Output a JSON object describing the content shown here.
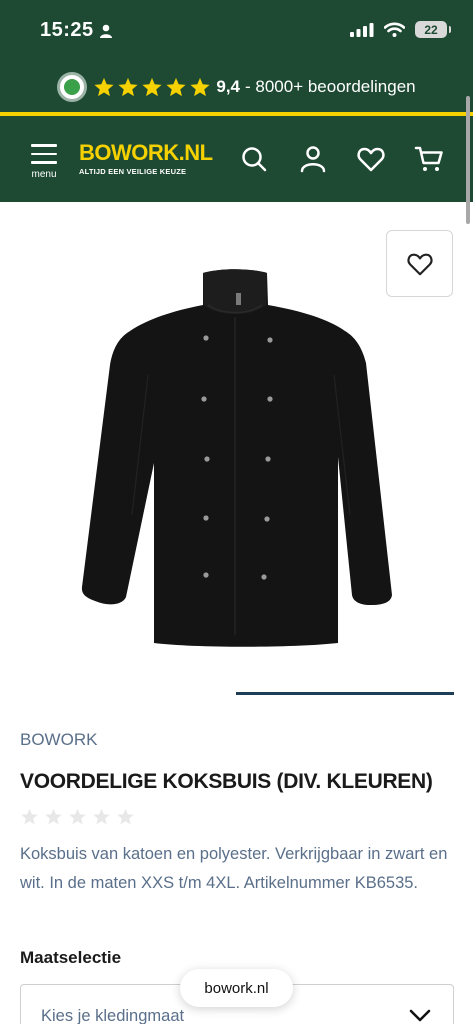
{
  "status_bar": {
    "time": "15:25",
    "battery": "22"
  },
  "rating_banner": {
    "score": "9,4",
    "reviews": "- 8000+ beoordelingen",
    "star_color": "#f5d100",
    "star_count": 5
  },
  "header": {
    "menu_label": "menu",
    "logo_title": "BOWORK.NL",
    "logo_subtitle": "ALTIJD EEN VEILIGE KEUZE",
    "icons": [
      "search-icon",
      "account-icon",
      "heart-icon",
      "cart-icon"
    ],
    "background_color": "#1e4a33",
    "accent_color": "#f5d100"
  },
  "product": {
    "brand": "BOWORK",
    "title": "VOORDELIGE KOKSBUIS (DIV. KLEUREN)",
    "rating_stars_filled": 0,
    "description": "Koksbuis van katoen en polyester. Verkrijgbaar in zwart en wit. In de maten XXS t/m 4XL. Artikelnummer KB6535.",
    "size_label": "Maatselectie",
    "size_placeholder": "Kies je kledingmaat"
  },
  "browser": {
    "url": "bowork.nl"
  }
}
